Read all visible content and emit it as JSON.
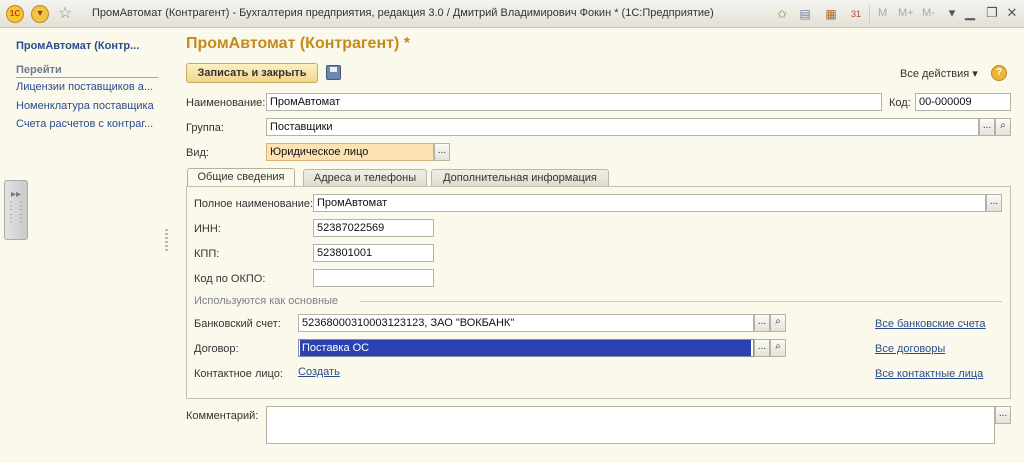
{
  "titlebar": {
    "logo": "1С",
    "title": "ПромАвтомат (Контрагент) - Бухгалтерия предприятия, редакция 3.0 / Дмитрий Владимирович Фокин * (1С:Предприятие)",
    "mem_buttons": [
      "M",
      "M+",
      "M-"
    ],
    "window_buttons": [
      "minimize-icon",
      "restore-icon",
      "close-icon"
    ]
  },
  "sidebar": {
    "title": "ПромАвтомат (Контр...",
    "section_label": "Перейти",
    "links": [
      {
        "label": "Лицензии поставщиков а..."
      },
      {
        "label": "Номенклатура поставщика"
      },
      {
        "label": "Счета расчетов с контраг..."
      }
    ]
  },
  "form": {
    "title": "ПромАвтомат (Контрагент) *",
    "save_close_label": "Записать и закрыть",
    "all_actions_label": "Все действия ▾",
    "help_label": "?",
    "name_label": "Наименование:",
    "name_value": "ПромАвтомат",
    "code_label": "Код:",
    "code_value": "00-000009",
    "group_label": "Группа:",
    "group_value": "Поставщики",
    "kind_label": "Вид:",
    "kind_value": "Юридическое лицо",
    "select_btn": "...",
    "comment_label": "Комментарий:"
  },
  "tabs": [
    {
      "label": "Общие сведения",
      "active": true
    },
    {
      "label": "Адреса и телефоны",
      "active": false
    },
    {
      "label": "Дополнительная информация",
      "active": false
    }
  ],
  "general": {
    "full_name_label": "Полное наименование:",
    "full_name_value": "ПромАвтомат",
    "inn_label": "ИНН:",
    "inn_value": "52387022569",
    "kpp_label": "КПП:",
    "kpp_value": "523801001",
    "okpo_label": "Код по ОКПО:",
    "okpo_value": "",
    "group_header": "Используются как основные",
    "bank_label": "Банковский счет:",
    "bank_value": "52368000310003123123, ЗАО \"ВОКБАНК\"",
    "bank_link": "Все банковские счета",
    "contract_label": "Договор:",
    "contract_value": "Поставка ОС",
    "contract_link": "Все договоры",
    "contact_label": "Контактное лицо:",
    "contact_create": "Создать",
    "contact_link": "Все контактные лица"
  },
  "colors": {
    "title_accent": "#c5891c",
    "link": "#2b4d8c",
    "selection": "#2b43b2",
    "required_field": "#fde3b3"
  }
}
